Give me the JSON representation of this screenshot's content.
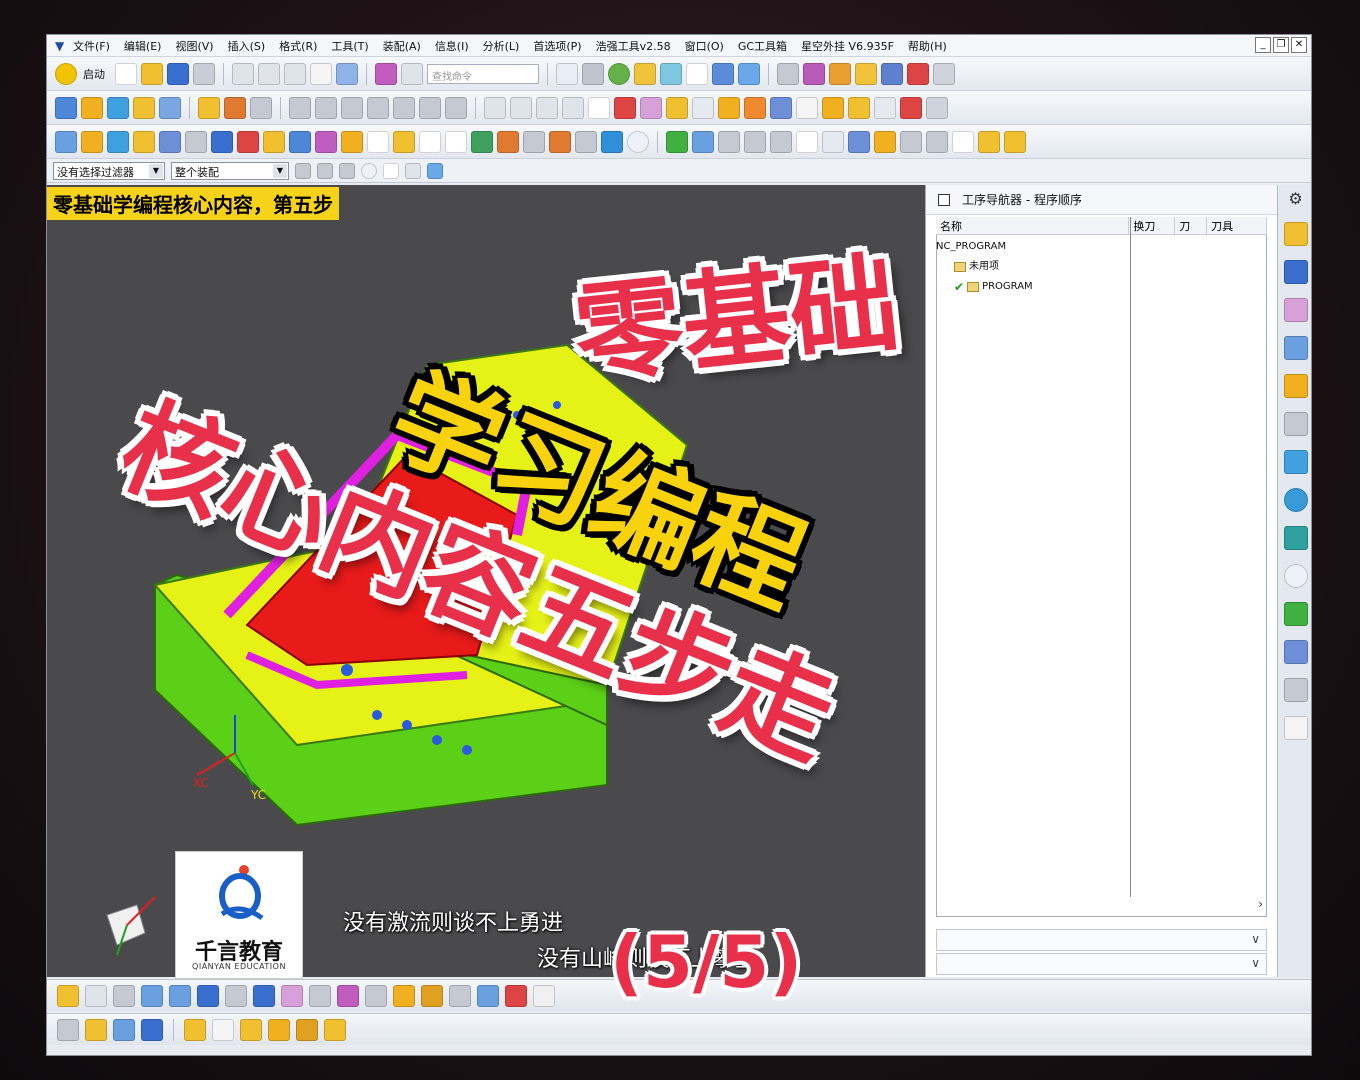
{
  "menu": {
    "items": [
      "文件(F)",
      "编辑(E)",
      "视图(V)",
      "插入(S)",
      "格式(R)",
      "工具(T)",
      "装配(A)",
      "信息(I)",
      "分析(L)",
      "首选项(P)",
      "浩强工具v2.58",
      "窗口(O)",
      "GC工具箱",
      "星空外挂 V6.935F",
      "帮助(H)"
    ]
  },
  "toolbar": {
    "start_label": "启动",
    "command_finder_placeholder": "查找命令"
  },
  "filter": {
    "selection_filter": "没有选择过滤器",
    "assembly_scope": "整个装配"
  },
  "banner": {
    "text": "零基础学编程核心内容，第五步"
  },
  "axes": {
    "xc": "XC",
    "yc": "YC"
  },
  "navigator": {
    "title": "工序导航器 - 程序顺序",
    "columns": [
      "名称",
      "换刀",
      "刀",
      "刀具"
    ],
    "tree": {
      "root": "NC_PROGRAM",
      "unused": "未用项",
      "program": "PROGRAM"
    }
  },
  "logo": {
    "name": "千言教育",
    "sub": "QIANYAN EDUCATION"
  },
  "subtitles": {
    "line1": "没有激流则谈不上勇进",
    "line2": "没有山峰则谈不上攀登"
  },
  "overlay": {
    "line1": "零基础",
    "line2": "学习编程",
    "line3": "核心内容五步走",
    "count": "(5/5)"
  },
  "colors": {
    "accent_pink": "#e8304a",
    "accent_yellow": "#f8d20c",
    "viewport_bg": "#4a4a4c"
  }
}
